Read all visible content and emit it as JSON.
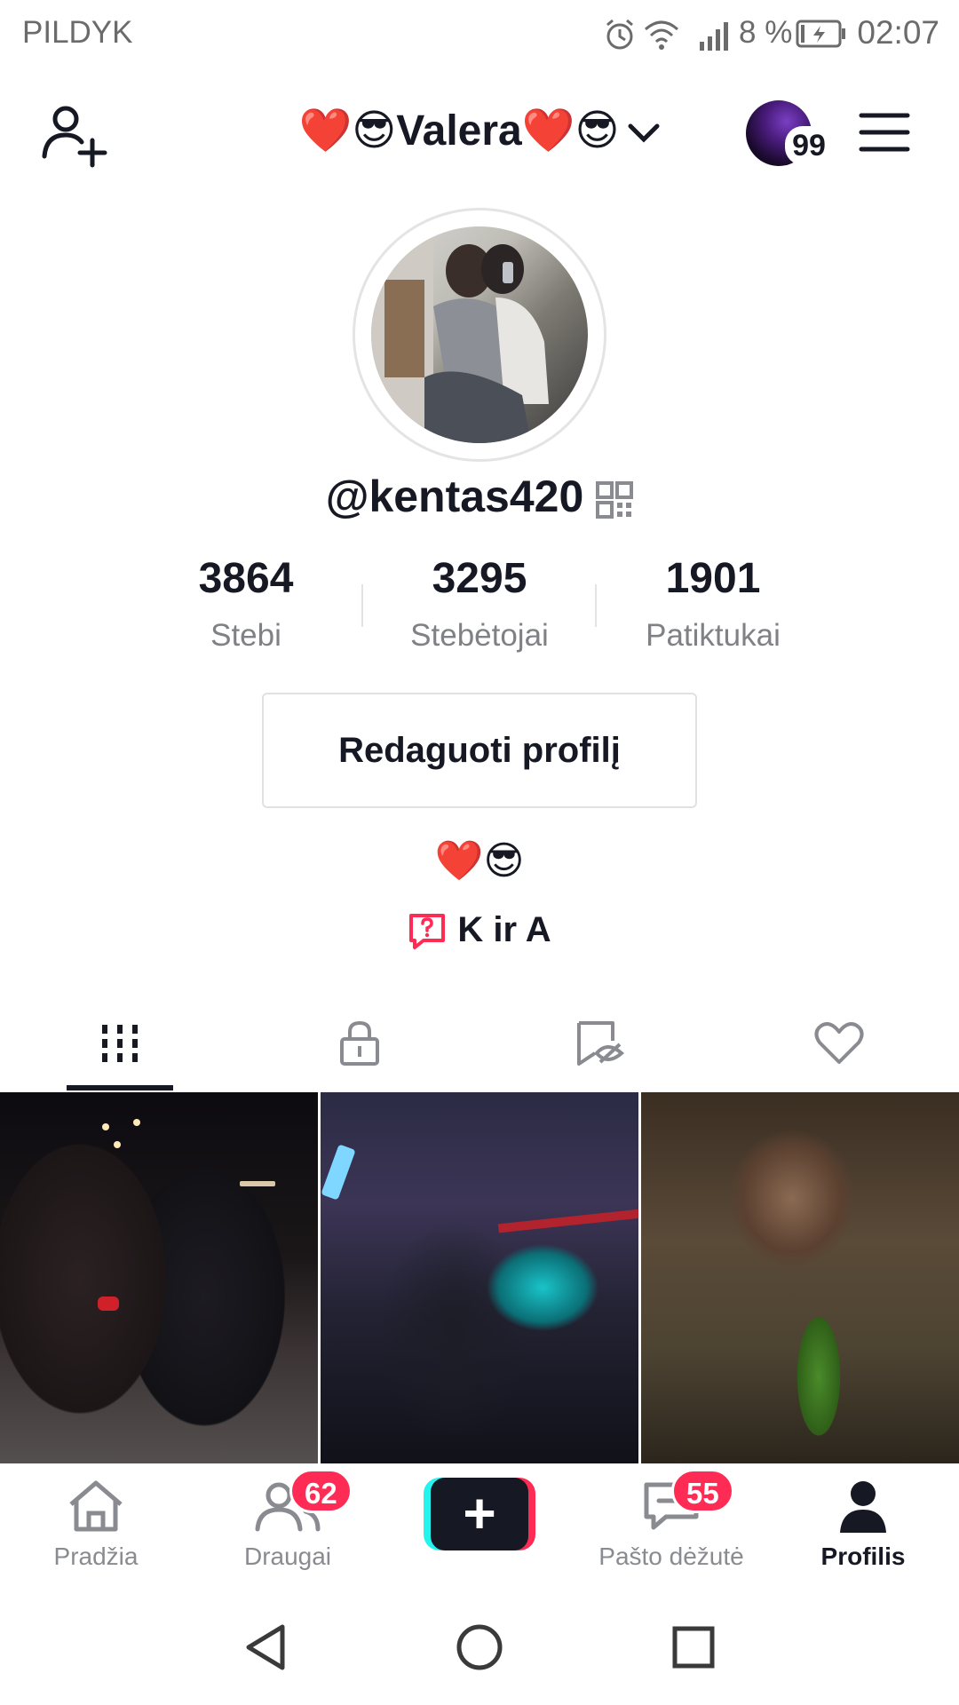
{
  "status_bar": {
    "carrier": "PILDYK",
    "battery": "8 %",
    "time": "02:07",
    "icons": [
      "alarm-icon",
      "wifi-icon",
      "signal-icon",
      "battery-charging-icon"
    ]
  },
  "header": {
    "display_name": "❤️😎Valera❤️😎",
    "notification_count": "99",
    "icons": [
      "add-user-icon",
      "chevron-down-icon",
      "menu-icon"
    ]
  },
  "profile": {
    "username": "@kentas420",
    "stats": [
      {
        "value": "3864",
        "label": "Stebi"
      },
      {
        "value": "3295",
        "label": "Stebėtojai"
      },
      {
        "value": "1901",
        "label": "Patiktukai"
      }
    ],
    "edit_button": "Redaguoti profilį",
    "bio": "❤️😎",
    "bio_link": "K ir A"
  },
  "tabs": [
    {
      "icon": "grid-icon",
      "active": true
    },
    {
      "icon": "lock-icon",
      "active": false
    },
    {
      "icon": "hidden-tag-icon",
      "active": false
    },
    {
      "icon": "heart-icon",
      "active": false
    }
  ],
  "bottom_nav": {
    "items": [
      {
        "label": "Pradžia",
        "icon": "home-icon"
      },
      {
        "label": "Draugai",
        "icon": "friends-icon",
        "badge": "62"
      },
      {
        "label": "",
        "icon": "plus-icon"
      },
      {
        "label": "Pašto dėžutė",
        "icon": "inbox-icon",
        "badge": "55"
      },
      {
        "label": "Profilis",
        "icon": "profile-icon",
        "active": true
      }
    ]
  },
  "colors": {
    "accent": "#fe2c55",
    "cyan": "#25f4ee",
    "text": "#161823",
    "muted": "#808185"
  }
}
